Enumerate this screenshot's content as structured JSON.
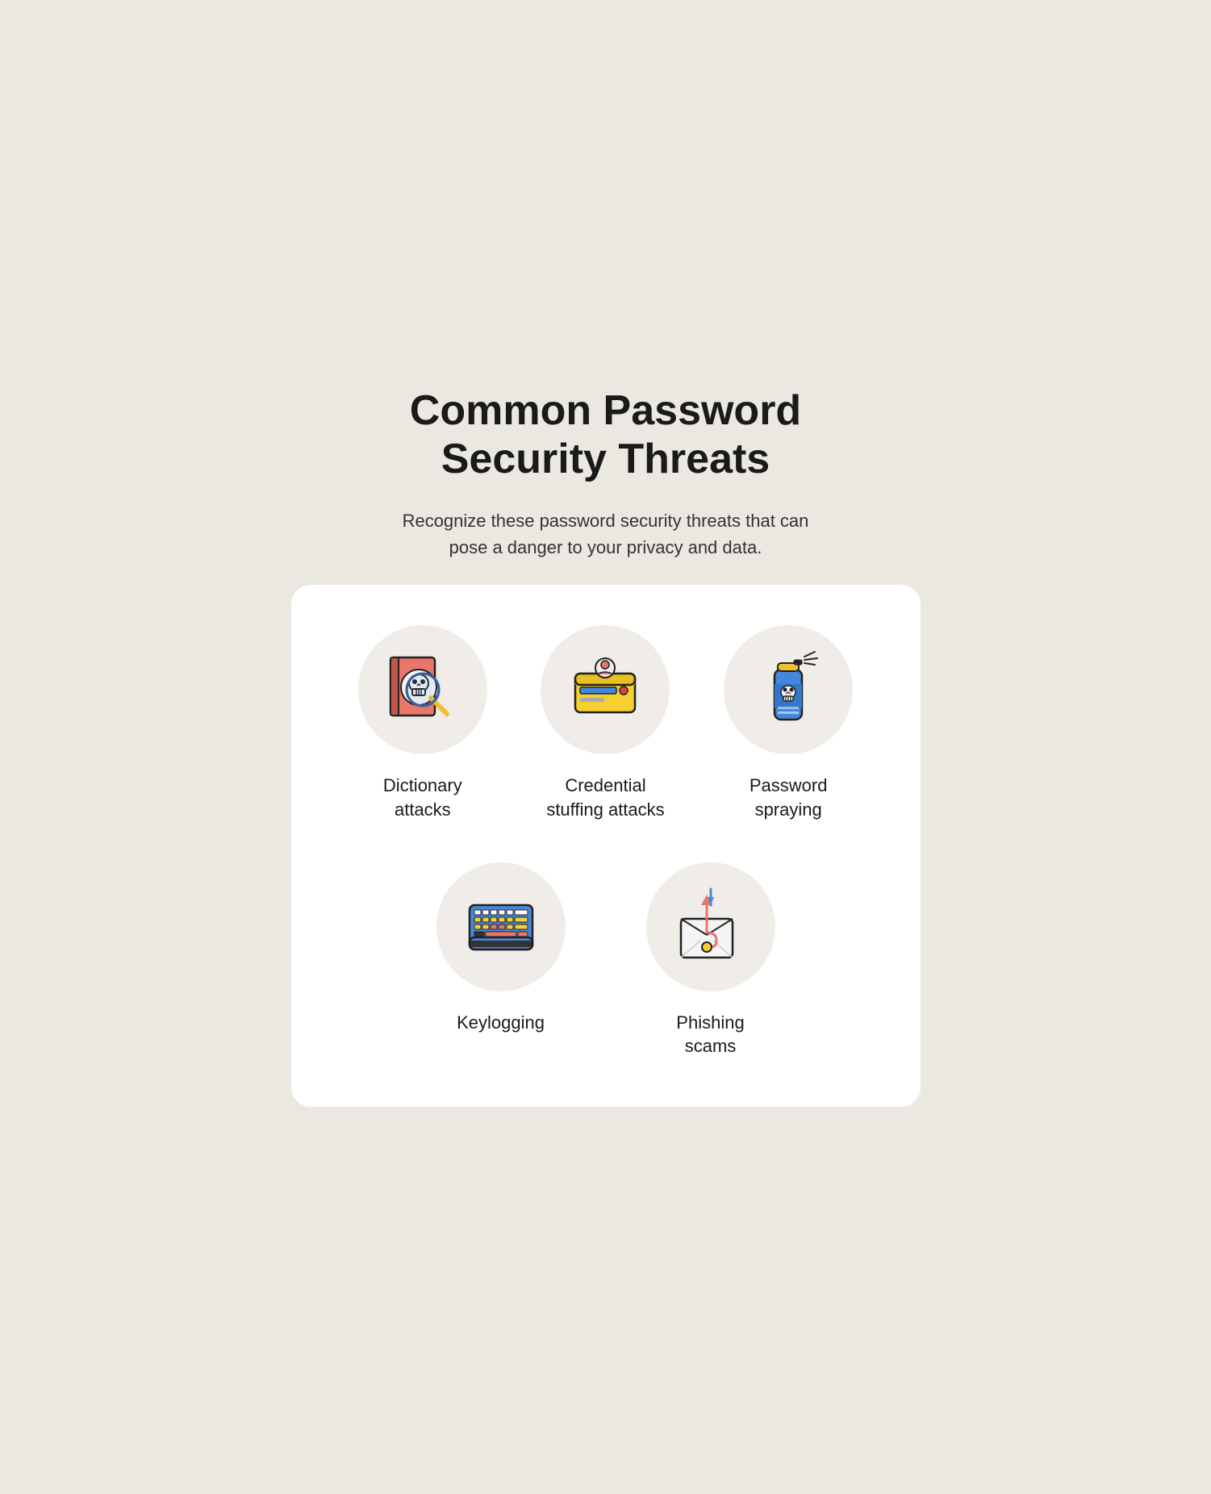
{
  "page": {
    "title": "Common Password\nSecurity Threats",
    "subtitle": "Recognize these password security threats that can pose a danger to your privacy and data.",
    "card": {
      "threats_top": [
        {
          "id": "dictionary-attacks",
          "label": "Dictionary\nattacks",
          "icon": "dictionary-icon"
        },
        {
          "id": "credential-stuffing",
          "label": "Credential\nstuffing attacks",
          "icon": "credential-icon"
        },
        {
          "id": "password-spraying",
          "label": "Password\nspraying",
          "icon": "spray-icon"
        }
      ],
      "threats_bottom": [
        {
          "id": "keylogging",
          "label": "Keylogging",
          "icon": "keyboard-icon"
        },
        {
          "id": "phishing-scams",
          "label": "Phishing\nscams",
          "icon": "phishing-icon"
        }
      ]
    }
  }
}
